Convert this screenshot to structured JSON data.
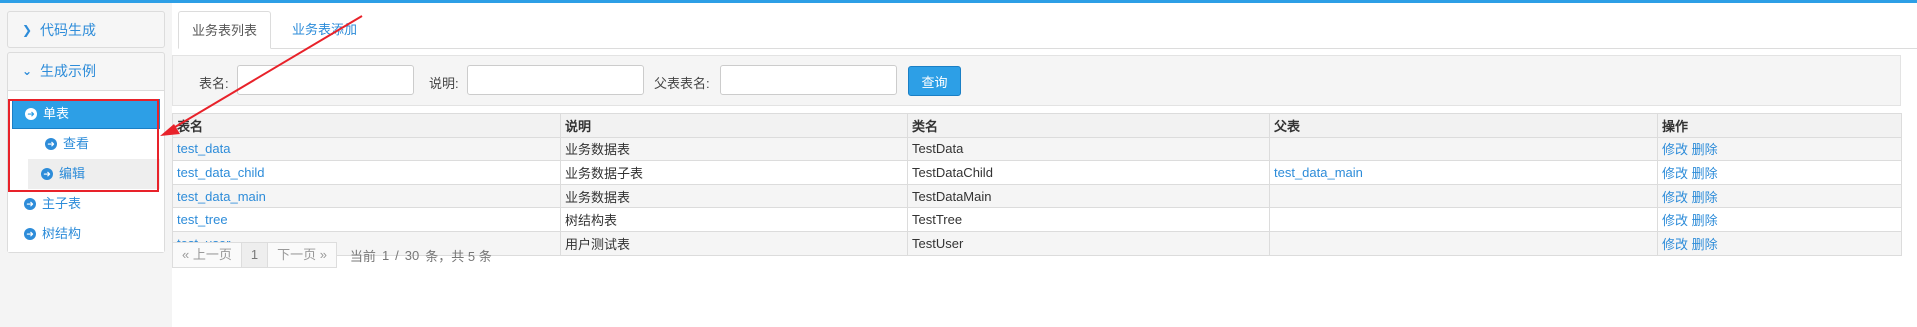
{
  "sidebar": {
    "panel1_title": "代码生成",
    "panel2_title": "生成示例",
    "items": [
      {
        "label": "单表"
      },
      {
        "label": "查看"
      },
      {
        "label": "编辑"
      },
      {
        "label": "主子表"
      },
      {
        "label": "树结构"
      }
    ]
  },
  "tabs": [
    {
      "label": "业务表列表"
    },
    {
      "label": "业务表添加"
    }
  ],
  "search": {
    "table_name_label": "表名:",
    "desc_label": "说明:",
    "parent_label": "父表表名:",
    "query_button": "查询",
    "table_name_value": "",
    "desc_value": "",
    "parent_value": ""
  },
  "table": {
    "headers": [
      "表名",
      "说明",
      "类名",
      "父表",
      "操作"
    ],
    "rows": [
      {
        "name": "test_data",
        "desc": "业务数据表",
        "class": "TestData",
        "parent": "",
        "edit": "修改",
        "delete": "删除"
      },
      {
        "name": "test_data_child",
        "desc": "业务数据子表",
        "class": "TestDataChild",
        "parent": "test_data_main",
        "edit": "修改",
        "delete": "删除"
      },
      {
        "name": "test_data_main",
        "desc": "业务数据表",
        "class": "TestDataMain",
        "parent": "",
        "edit": "修改",
        "delete": "删除"
      },
      {
        "name": "test_tree",
        "desc": "树结构表",
        "class": "TestTree",
        "parent": "",
        "edit": "修改",
        "delete": "删除"
      },
      {
        "name": "test_user",
        "desc": "用户测试表",
        "class": "TestUser",
        "parent": "",
        "edit": "修改",
        "delete": "删除"
      }
    ]
  },
  "pager": {
    "prev": "« 上一页",
    "current_page": "1",
    "next": "下一页 »",
    "current_label": "当前",
    "page_input": "1",
    "slash": "/",
    "page_size": "30",
    "total_text": "条，共 5 条"
  },
  "colors": {
    "accent": "#2d9fe6",
    "link": "#2d8cd9",
    "annotation_red": "#e8222a"
  }
}
